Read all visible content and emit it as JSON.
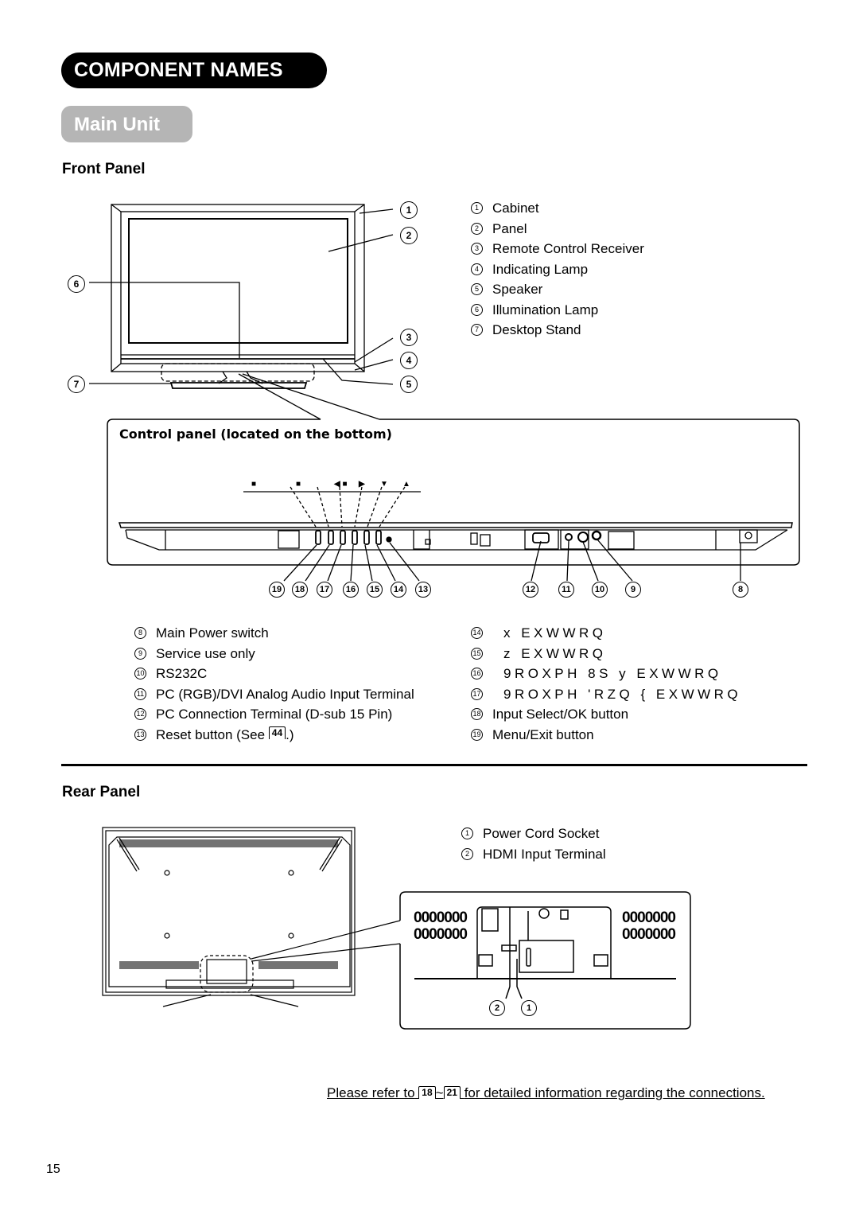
{
  "header": {
    "title": "COMPONENT NAMES",
    "subtitle": "Main Unit"
  },
  "front_panel": {
    "heading": "Front Panel",
    "callouts": [
      "1",
      "2",
      "3",
      "4",
      "5",
      "6",
      "7"
    ],
    "items": [
      {
        "num": "1",
        "label": "Cabinet"
      },
      {
        "num": "2",
        "label": "Panel"
      },
      {
        "num": "3",
        "label": "Remote Control Receiver"
      },
      {
        "num": "4",
        "label": "Indicating Lamp"
      },
      {
        "num": "5",
        "label": "Speaker"
      },
      {
        "num": "6",
        "label": "Illumination Lamp"
      },
      {
        "num": "7",
        "label": "Desktop Stand"
      }
    ]
  },
  "control_panel": {
    "heading": "Control panel (located on the bottom)",
    "button_glyphs": [
      "■",
      "■",
      "◀ ■",
      "▶",
      "▼",
      "▲"
    ],
    "callouts_left": [
      "19",
      "18",
      "17",
      "16",
      "15",
      "14",
      "13"
    ],
    "callouts_right": [
      "12",
      "11",
      "10",
      "9",
      "8"
    ],
    "items_left": [
      {
        "num": "8",
        "label": "Main Power switch"
      },
      {
        "num": "9",
        "label": "Service use only"
      },
      {
        "num": "10",
        "label": "RS232C"
      },
      {
        "num": "11",
        "label": "PC (RGB)/DVI Analog Audio Input Terminal"
      },
      {
        "num": "12",
        "label": "PC Connection Terminal (D-sub 15 Pin)"
      },
      {
        "num": "13",
        "label": "Reset button (See",
        "page_ref": "44",
        "suffix": ".)"
      }
    ],
    "items_right": [
      {
        "num": "14",
        "label": "x EXWWRQ",
        "garbled": true
      },
      {
        "num": "15",
        "label": "z EXWWRQ",
        "garbled": true
      },
      {
        "num": "16",
        "label": "9ROXPH 8S y EXWWRQ",
        "garbled": true
      },
      {
        "num": "17",
        "label": "9ROXPH 'RZQ { EXWWRQ",
        "garbled": true
      },
      {
        "num": "18",
        "label": "Input Select/OK button"
      },
      {
        "num": "19",
        "label": "Menu/Exit button"
      }
    ]
  },
  "rear_panel": {
    "heading": "Rear Panel",
    "callouts": [
      "2",
      "1"
    ],
    "items": [
      {
        "num": "1",
        "label": "Power Cord Socket"
      },
      {
        "num": "2",
        "label": "HDMI Input Terminal"
      }
    ]
  },
  "footer": {
    "note_prefix": "Please refer to",
    "ref_start": "18",
    "ref_sep": "~",
    "ref_end": "21",
    "note_suffix": "for detailed information regarding the connections.",
    "page_number": "15"
  }
}
